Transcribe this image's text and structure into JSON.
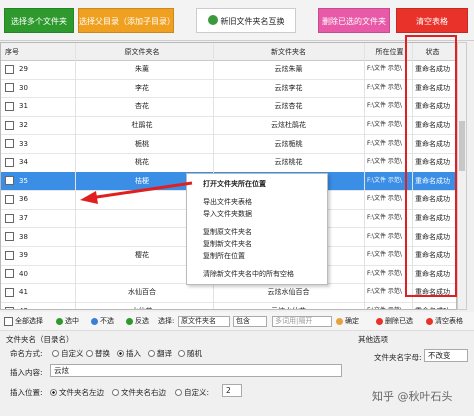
{
  "toolbar": {
    "add_multiple": "选择多个文件夹",
    "add_from_parent": "选择父目录（添加子目录）",
    "swap_names": "新旧文件夹名互换",
    "delete_selected": "删除已选的文件夹",
    "clear_table": "清空表格"
  },
  "table": {
    "headers": {
      "index": "序号",
      "original": "原文件夹名",
      "new": "新文件夹名",
      "location": "所在位置",
      "status": "状态"
    },
    "rows": [
      {
        "index": "29",
        "original": "朱薰",
        "new": "云炫朱薰",
        "location": "F:\\文件 示范\\",
        "status": "重命名成功"
      },
      {
        "index": "30",
        "original": "李花",
        "new": "云炫李花",
        "location": "F:\\文件 示范\\",
        "status": "重命名成功"
      },
      {
        "index": "31",
        "original": "杏花",
        "new": "云炫杏花",
        "location": "F:\\文件 示范\\",
        "status": "重命名成功"
      },
      {
        "index": "32",
        "original": "杜鹃花",
        "new": "云炫杜鹃花",
        "location": "F:\\文件 示范\\",
        "status": "重命名成功"
      },
      {
        "index": "33",
        "original": "栀桃",
        "new": "云炫栀桃",
        "location": "F:\\文件 示范\\",
        "status": "重命名成功"
      },
      {
        "index": "34",
        "original": "桃花",
        "new": "云炫桃花",
        "location": "F:\\文件 示范\\",
        "status": "重命名成功"
      },
      {
        "index": "35",
        "original": "桔梗",
        "new": "云炫桔梗",
        "location": "F:\\文件 示范\\",
        "status": "重命名成功"
      },
      {
        "index": "36",
        "original": "",
        "new": "",
        "location": "F:\\文件 示范\\",
        "status": "重命名成功"
      },
      {
        "index": "37",
        "original": "",
        "new": "",
        "location": "F:\\文件 示范\\",
        "status": "重命名成功"
      },
      {
        "index": "38",
        "original": "",
        "new": "",
        "location": "F:\\文件 示范\\",
        "status": "重命名成功"
      },
      {
        "index": "39",
        "original": "樱花",
        "new": "",
        "location": "F:\\文件 示范\\",
        "status": "重命名成功"
      },
      {
        "index": "40",
        "original": "",
        "new": "",
        "location": "F:\\文件 示范\\",
        "status": "重命名成功"
      },
      {
        "index": "41",
        "original": "水仙百合",
        "new": "云炫水仙百合",
        "location": "F:\\文件 示范\\",
        "status": "重命名成功"
      },
      {
        "index": "42",
        "original": "水仙花",
        "new": "云炫水仙花",
        "location": "F:\\文件 示范\\",
        "status": "重命名成功"
      }
    ]
  },
  "context_menu": [
    "打开文件夹所在位置",
    "导出文件夹表格",
    "导入文件夹数据",
    "复制原文件夹名",
    "复制新文件夹名",
    "复制所在位置",
    "清除新文件夹名中的所有空格"
  ],
  "selection_bar": {
    "select_all": "全部选择",
    "select": "选中",
    "deselect": "不选",
    "invert": "反选",
    "choose_label": "选择:",
    "field_value": "原文件夹名",
    "mode_value": "包含",
    "search_placeholder": "多词用|隔开",
    "confirm": "确定",
    "delete_checked": "删除已选",
    "clear_table": "清空表格"
  },
  "name_panel": {
    "title": "文件夹名（目录名）",
    "method_label": "命名方式:",
    "opt_custom": "自定义",
    "opt_replace": "替换",
    "opt_insert": "插入",
    "opt_translate": "翻译",
    "opt_random": "随机",
    "content_label": "插入内容:",
    "content_value": "云炫",
    "pos_label": "插入位置:",
    "pos_left": "文件夹名左边",
    "pos_right": "文件夹名右边",
    "pos_custom": "自定义:",
    "pos_custom_value": "2"
  },
  "other_panel": {
    "title": "其他选项",
    "case_label": "文件夹名字母:",
    "case_value": "不改变"
  },
  "watermark": "知乎 @秋叶石头",
  "colors": {
    "green": "#2e9a2e",
    "orange": "#f0a020",
    "pink": "#e85aa8",
    "red": "#e8322a",
    "selected": "#3a8ee6",
    "frame": "#e02020"
  }
}
